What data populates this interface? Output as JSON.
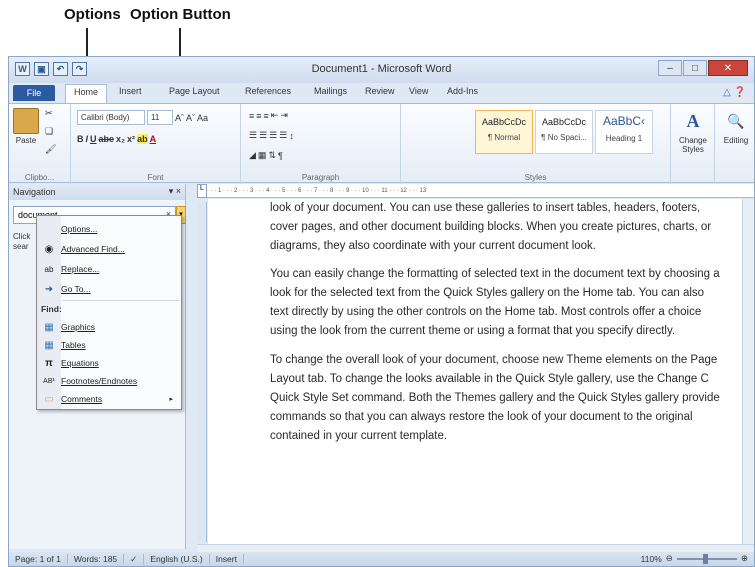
{
  "annotations": {
    "options": "Options",
    "option_button": "Option Button"
  },
  "window": {
    "title": "Document1 - Microsoft Word"
  },
  "tabs": {
    "file": "File",
    "home": "Home",
    "insert": "Insert",
    "page_layout": "Page Layout",
    "references": "References",
    "mailings": "Mailings",
    "review": "Review",
    "view": "View",
    "addins": "Add-Ins"
  },
  "ribbon": {
    "clipboard": {
      "paste": "Paste",
      "label": "Clipbo..."
    },
    "font": {
      "name": "Calibri (Body)",
      "size": "11",
      "label": "Font"
    },
    "paragraph": {
      "label": "Paragraph"
    },
    "styles": {
      "label": "Styles",
      "items": [
        {
          "preview": "AaBbCcDc",
          "name": "¶ Normal"
        },
        {
          "preview": "AaBbCcDc",
          "name": "¶ No Spaci..."
        },
        {
          "preview": "AaBbC‹",
          "name": "Heading 1"
        }
      ],
      "change": "Change Styles"
    },
    "editing": {
      "label": "Editing"
    }
  },
  "nav": {
    "title": "Navigation",
    "search_value": "document",
    "hint1": "Click",
    "hint2": "sear"
  },
  "menu": {
    "items_top": [
      {
        "icon": "",
        "label": "Options...",
        "name": "options"
      },
      {
        "icon": "🔭",
        "label": "Advanced Find...",
        "name": "advanced-find"
      },
      {
        "icon": "ab",
        "label": "Replace...",
        "name": "replace"
      },
      {
        "icon": "➜",
        "label": "Go To...",
        "name": "go-to"
      }
    ],
    "find_header": "Find:",
    "items_find": [
      {
        "icon": "🖼",
        "label": "Graphics",
        "name": "graphics"
      },
      {
        "icon": "▦",
        "label": "Tables",
        "name": "tables"
      },
      {
        "icon": "π",
        "label": "Equations",
        "name": "equations"
      },
      {
        "icon": "AB¹",
        "label": "Footnotes/Endnotes",
        "name": "footnotes-endnotes"
      },
      {
        "icon": "▭",
        "label": "Comments",
        "name": "comments",
        "submenu": "▸"
      }
    ]
  },
  "document": {
    "lines": [
      "look of your document. You can use these galleries to insert tables, headers, footers,",
      "cover pages, and other document building blocks. When you create pictures, charts, or",
      "diagrams, they also coordinate with your current document look.",
      "You can easily change the formatting of selected text in the document text by choosing a",
      "look for the selected text from the Quick Styles gallery on the Home tab. You can also",
      "text directly by using the other controls on the Home tab. Most controls offer a choice",
      "using the look from the current theme or using a format that you specify directly.",
      "To change the overall look of your document, choose new Theme elements on the Page",
      "Layout tab. To change the looks available in the Quick Style gallery, use the Change C",
      "Quick Style Set command. Both the Themes gallery and the Quick Styles gallery provide",
      "commands so that you can always restore the look of your document to the original",
      "contained in your current template."
    ]
  },
  "status": {
    "page": "Page: 1 of 1",
    "words": "Words: 185",
    "language": "English (U.S.)",
    "mode": "Insert",
    "zoom": "110%"
  }
}
